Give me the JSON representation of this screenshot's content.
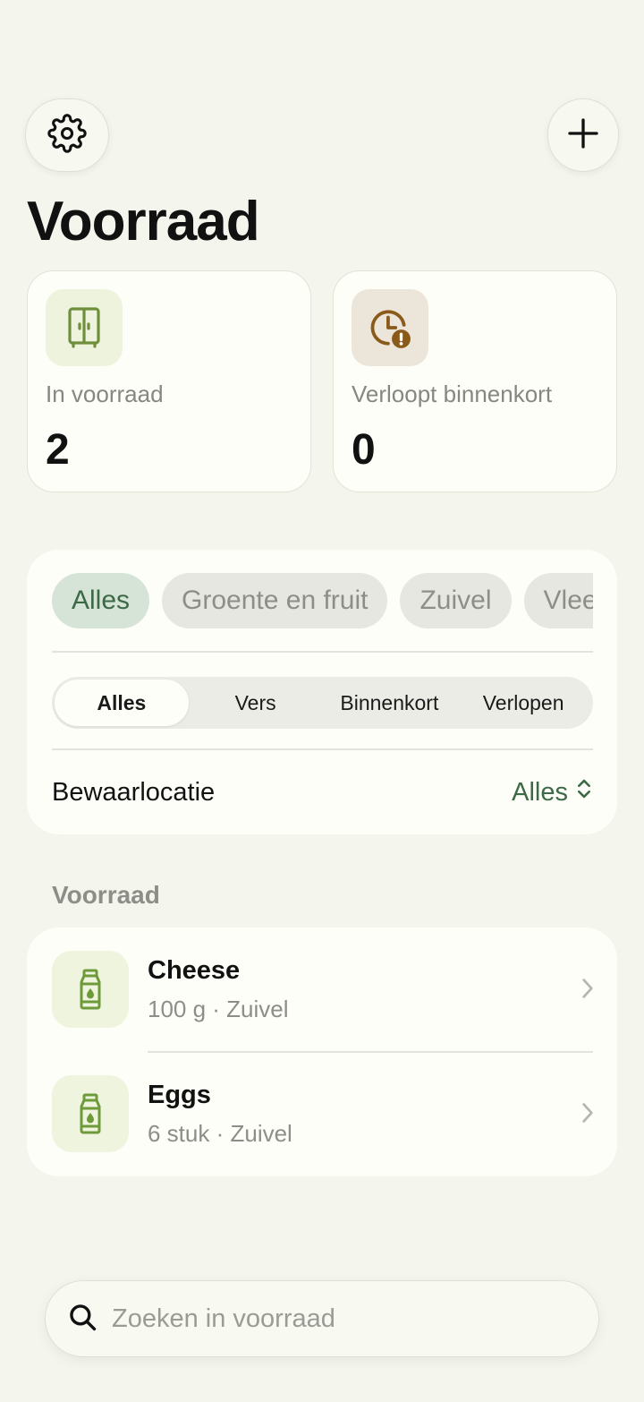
{
  "header": {
    "settings_icon": "gear-icon",
    "add_icon": "plus-icon",
    "title": "Voorraad"
  },
  "stats": {
    "in_stock": {
      "label": "In voorraad",
      "value": "2",
      "icon": "cabinet-icon",
      "icon_bg": "#eef3dd",
      "icon_color": "#6f8f3c"
    },
    "expiring": {
      "label": "Verloopt binnenkort",
      "value": "0",
      "icon": "clock-alert-icon",
      "icon_bg": "#ece5d9",
      "icon_color": "#8a5a1a"
    }
  },
  "filters": {
    "categories": [
      "Alles",
      "Groente en fruit",
      "Zuivel",
      "Vlees"
    ],
    "active_category": "Alles",
    "status_tabs": [
      "Alles",
      "Vers",
      "Binnenkort",
      "Verlopen"
    ],
    "active_status": "Alles",
    "location_label": "Bewaarlocatie",
    "location_value": "Alles"
  },
  "section": {
    "title": "Voorraad"
  },
  "items": [
    {
      "name": "Cheese",
      "meta": "100 g · Zuivel",
      "icon": "bottle-icon"
    },
    {
      "name": "Eggs",
      "meta": "6 stuk · Zuivel",
      "icon": "bottle-icon"
    }
  ],
  "search": {
    "placeholder": "Zoeken in voorraad",
    "value": ""
  },
  "colors": {
    "background": "#f4f5ec",
    "accent": "#3c6946",
    "card": "#fefef9"
  }
}
